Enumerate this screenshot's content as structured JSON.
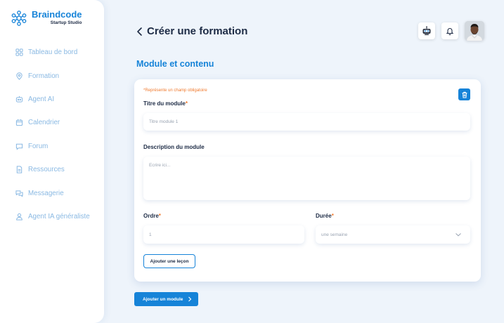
{
  "brand": {
    "name": "Braindcode",
    "subtitle": "Startup Studio"
  },
  "sidebar": {
    "items": [
      {
        "label": "Tableau de bord",
        "icon": "dashboard-icon"
      },
      {
        "label": "Formation",
        "icon": "location-pin-icon"
      },
      {
        "label": "Agent AI",
        "icon": "ai-agent-icon"
      },
      {
        "label": "Calendrier",
        "icon": "calendar-icon"
      },
      {
        "label": "Forum",
        "icon": "chat-bubble-icon"
      },
      {
        "label": "Ressources",
        "icon": "document-icon"
      },
      {
        "label": "Messagerie",
        "icon": "messages-icon"
      },
      {
        "label": "Agent IA généraliste",
        "icon": "user-icon"
      }
    ]
  },
  "header": {
    "title": "Créer une formation",
    "back_icon": "chevron-left-icon"
  },
  "top_actions": {
    "robot_icon": "robot-icon",
    "bell_icon": "bell-icon",
    "avatar": "user-avatar"
  },
  "section": {
    "title": "Module et contenu"
  },
  "form": {
    "required_note": "*Représente un champ obligatoire",
    "title_label": "Titre du module",
    "title_placeholder": "Titre module 1",
    "description_label": "Description du module",
    "description_placeholder": "Ecrire ici...",
    "order_label": "Ordre",
    "order_value": "1",
    "duration_label": "Durée",
    "duration_value": "une semaine",
    "required_mark": "*",
    "add_lesson": "Ajouter une leçon",
    "delete_icon": "trash-icon"
  },
  "add_module_button": "Ajouter un module",
  "colors": {
    "accent": "#1683d8",
    "required": "#f07a2e",
    "title": "#1d2b45",
    "nav_text": "#8ab9e3",
    "background": "#eef4fb"
  }
}
